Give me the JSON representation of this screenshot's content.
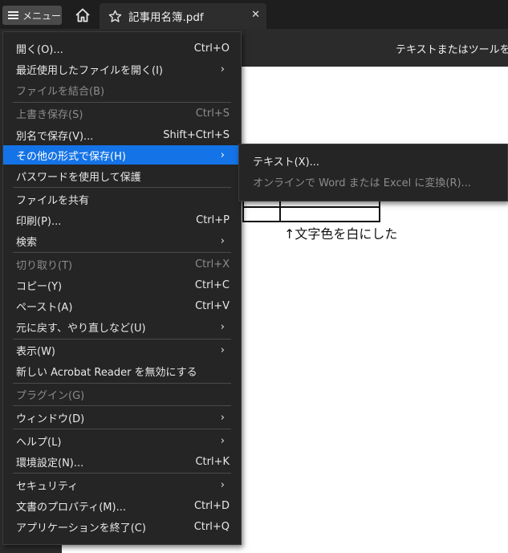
{
  "tabbar": {
    "menu_label": "メニュー",
    "home_icon": "home-icon",
    "tab_title": "記事用名簿.pdf",
    "close_glyph": "✕"
  },
  "toolbar": {
    "search_hint": "テキストまたはツールを検索"
  },
  "document": {
    "note": "↑文字色を白にした"
  },
  "menu": {
    "items": [
      {
        "label": "開く(O)...",
        "shortcut": "Ctrl+O"
      },
      {
        "label": "最近使用したファイルを開く(I)",
        "shortcut": ""
      },
      {
        "label": "ファイルを結合(B)",
        "shortcut": ""
      },
      {
        "label": "上書き保存(S)",
        "shortcut": "Ctrl+S"
      },
      {
        "label": "別名で保存(V)...",
        "shortcut": "Shift+Ctrl+S"
      },
      {
        "label": "その他の形式で保存(H)",
        "shortcut": ""
      },
      {
        "label": "パスワードを使用して保護",
        "shortcut": ""
      },
      {
        "label": "ファイルを共有",
        "shortcut": ""
      },
      {
        "label": "印刷(P)...",
        "shortcut": "Ctrl+P"
      },
      {
        "label": "検索",
        "shortcut": ""
      },
      {
        "label": "切り取り(T)",
        "shortcut": "Ctrl+X"
      },
      {
        "label": "コピー(Y)",
        "shortcut": "Ctrl+C"
      },
      {
        "label": "ペースト(A)",
        "shortcut": "Ctrl+V"
      },
      {
        "label": "元に戻す、やり直しなど(U)",
        "shortcut": ""
      },
      {
        "label": "表示(W)",
        "shortcut": ""
      },
      {
        "label": "新しい Acrobat Reader を無効にする",
        "shortcut": ""
      },
      {
        "label": "プラグイン(G)",
        "shortcut": ""
      },
      {
        "label": "ウィンドウ(D)",
        "shortcut": ""
      },
      {
        "label": "ヘルプ(L)",
        "shortcut": ""
      },
      {
        "label": "環境設定(N)...",
        "shortcut": "Ctrl+K"
      },
      {
        "label": "セキュリティ",
        "shortcut": ""
      },
      {
        "label": "文書のプロパティ(M)...",
        "shortcut": "Ctrl+D"
      },
      {
        "label": "アプリケーションを終了(C)",
        "shortcut": "Ctrl+Q"
      }
    ]
  },
  "submenu": {
    "items": [
      {
        "label": "テキスト(X)..."
      },
      {
        "label": "オンラインで Word または Excel に変換(R)..."
      }
    ]
  },
  "colors": {
    "accent": "#1473e6",
    "menu_bg": "#252525",
    "disabled": "#8c8c8c"
  }
}
